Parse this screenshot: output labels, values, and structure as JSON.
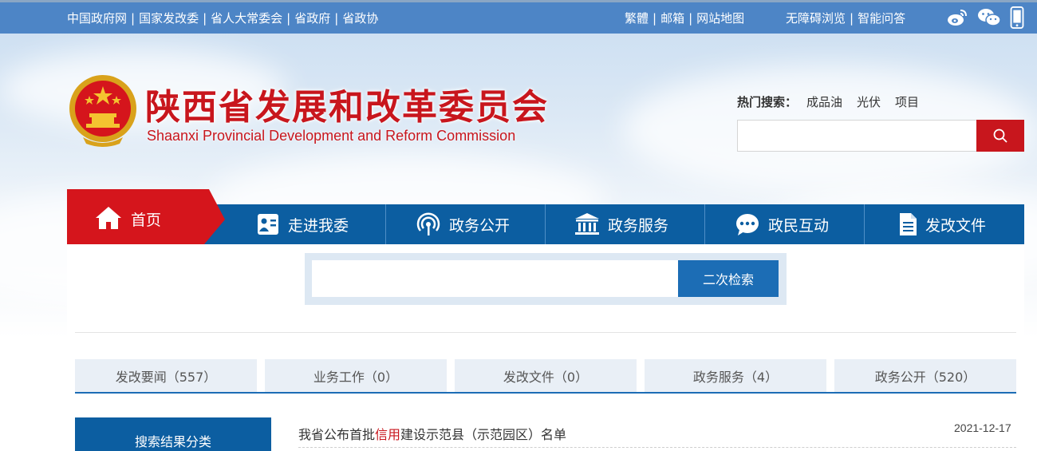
{
  "topbar": {
    "left_links": [
      "中国政府网",
      "国家发改委",
      "省人大常委会",
      "省政府",
      "省政协"
    ],
    "right_links_1": [
      "繁體",
      "邮箱",
      "网站地图"
    ],
    "right_links_2": [
      "无障碍浏览",
      "智能问答"
    ],
    "separator": "|",
    "icons": [
      "weibo-icon",
      "wechat-icon",
      "mobile-icon"
    ]
  },
  "header": {
    "title": "陕西省发展和改革委员会",
    "subtitle": "Shaanxi Provincial Development and Reform Commission",
    "hot_search_label": "热门搜索：",
    "hot_search_terms": [
      "成品油",
      "光伏",
      "项目"
    ],
    "search_value": ""
  },
  "nav": {
    "home": "首页",
    "items": [
      "走进我委",
      "政务公开",
      "政务服务",
      "政民互动",
      "发改文件"
    ]
  },
  "sub_search": {
    "value": "",
    "button": "二次检索"
  },
  "tabs": [
    "发改要闻（557）",
    "业务工作（0）",
    "发改文件（0）",
    "政务服务（4）",
    "政务公开（520）"
  ],
  "sidebar": {
    "title": "搜索结果分类"
  },
  "results": [
    {
      "title_before": "我省公布首批",
      "title_highlight": "信用",
      "title_after": "建设示范县（示范园区）名单",
      "date": "2021-12-17"
    }
  ],
  "colors": {
    "brand_red": "#c8161d",
    "nav_blue": "#0c5ea1",
    "topbar_blue": "#4d85c6",
    "button_blue": "#1c6db5"
  }
}
